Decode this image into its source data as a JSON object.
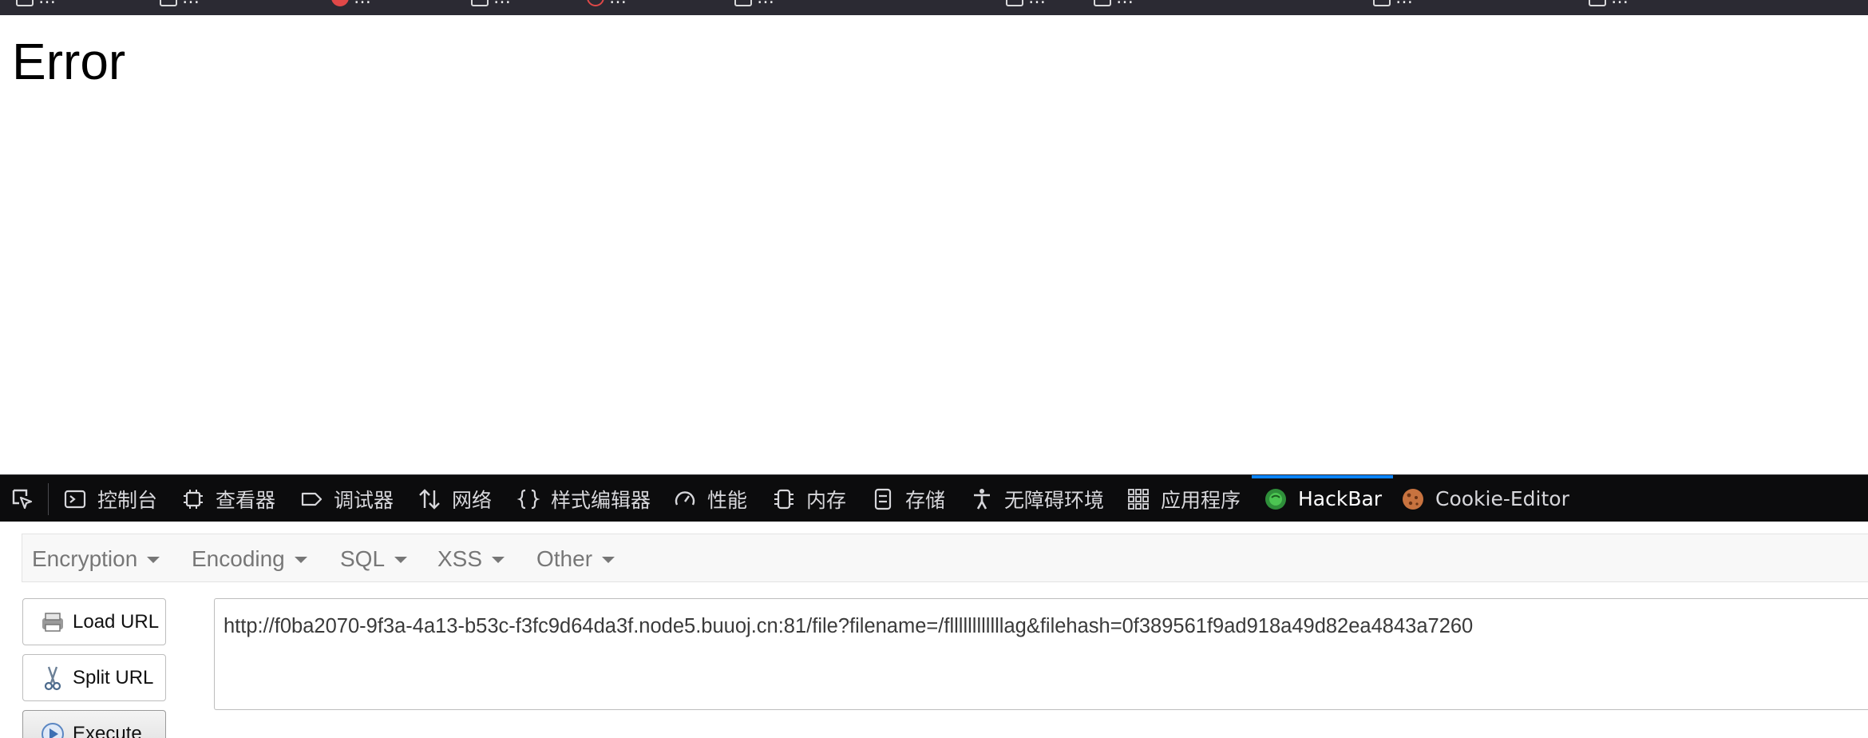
{
  "bookmarks": [
    {
      "label": "…",
      "icon": "folder-icon"
    },
    {
      "label": "…",
      "icon": "folder-icon"
    },
    {
      "label": "…",
      "icon": "red-circle-icon"
    },
    {
      "label": "…",
      "icon": "folder-icon"
    },
    {
      "label": "…",
      "icon": "shield-icon"
    },
    {
      "label": "…",
      "icon": "page-icon"
    },
    {
      "label": "…",
      "icon": "folder-icon"
    },
    {
      "label": "…",
      "icon": "folder-icon"
    },
    {
      "label": "…",
      "icon": "folder-icon"
    },
    {
      "label": "…",
      "icon": "folder-icon"
    }
  ],
  "page": {
    "heading": "Error"
  },
  "devtools": {
    "tabs": [
      {
        "label": "控制台",
        "icon": "console-icon"
      },
      {
        "label": "查看器",
        "icon": "inspector-icon"
      },
      {
        "label": "调试器",
        "icon": "debugger-icon"
      },
      {
        "label": "网络",
        "icon": "network-icon"
      },
      {
        "label": "样式编辑器",
        "icon": "braces-icon"
      },
      {
        "label": "性能",
        "icon": "gauge-icon"
      },
      {
        "label": "内存",
        "icon": "memory-icon"
      },
      {
        "label": "存储",
        "icon": "storage-icon"
      },
      {
        "label": "无障碍环境",
        "icon": "accessibility-icon"
      },
      {
        "label": "应用程序",
        "icon": "grid-icon"
      },
      {
        "label": "HackBar",
        "icon": "hackbar-icon",
        "active": true
      },
      {
        "label": "Cookie-Editor",
        "icon": "cookie-icon"
      }
    ],
    "accent_color": "#0a84ff"
  },
  "hackbar": {
    "menu": [
      {
        "label": "Encryption"
      },
      {
        "label": "Encoding"
      },
      {
        "label": "SQL"
      },
      {
        "label": "XSS"
      },
      {
        "label": "Other"
      }
    ],
    "buttons": {
      "load_url": "Load URL",
      "split_url": "Split URL",
      "execute": "Execute"
    },
    "url": "http://f0ba2070-9f3a-4a13-b53c-f3fc9d64da3f.node5.buuoj.cn:81/file?filename=/fllllllllllllag&filehash=0f389561f9ad918a49d82ea4843a7260"
  }
}
